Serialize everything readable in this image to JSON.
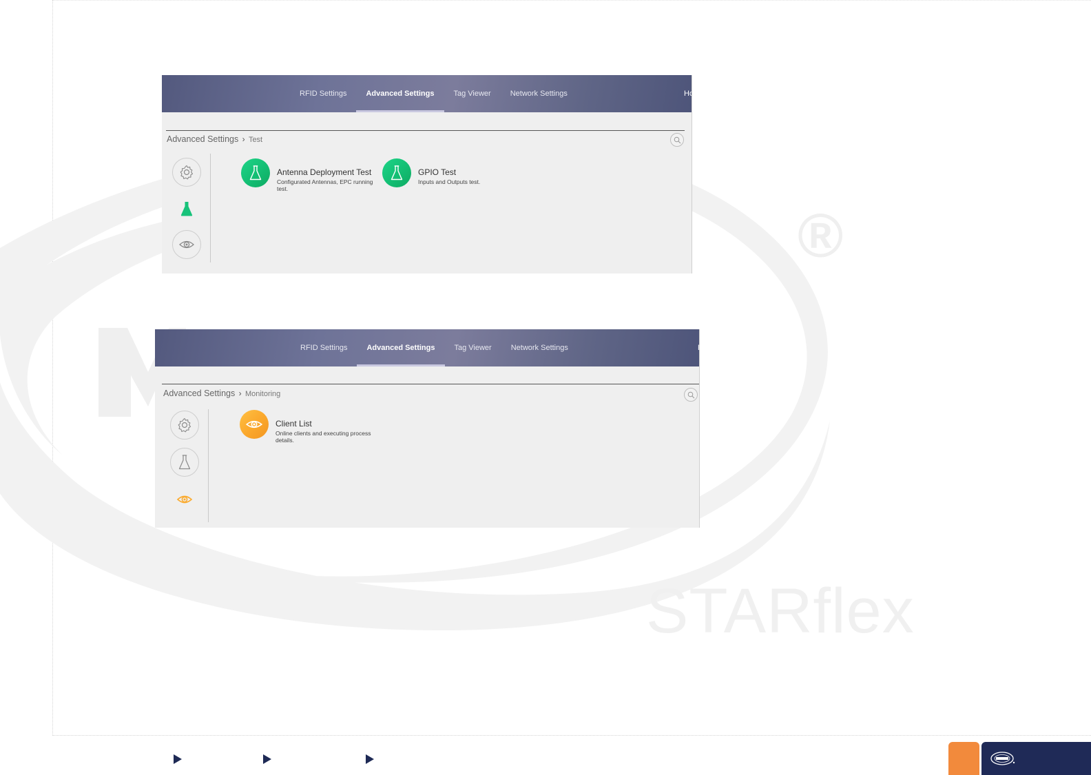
{
  "panels": {
    "test": {
      "nav": {
        "tabs": [
          "RFID Settings",
          "Advanced Settings",
          "Tag Viewer",
          "Network Settings"
        ],
        "active": "Advanced Settings",
        "right_label": "Ho"
      },
      "breadcrumb": {
        "root": "Advanced Settings",
        "separator": "›",
        "current": "Test"
      },
      "sidebar": [
        {
          "icon": "gear-icon",
          "active": false
        },
        {
          "icon": "flask-icon",
          "active": true
        },
        {
          "icon": "eye-icon",
          "active": false
        }
      ],
      "tiles": [
        {
          "icon": "flask-icon",
          "color": "#17c27a",
          "title": "Antenna Deployment Test",
          "desc_line1": "Configurated Antennas, EPC running",
          "desc_line2": "test."
        },
        {
          "icon": "flask-icon",
          "color": "#17c27a",
          "title": "GPIO Test",
          "desc_line1": "Inputs and Outputs test.",
          "desc_line2": ""
        }
      ]
    },
    "monitoring": {
      "nav": {
        "tabs": [
          "RFID Settings",
          "Advanced Settings",
          "Tag Viewer",
          "Network Settings"
        ],
        "active": "Advanced Settings",
        "right_label": "F"
      },
      "breadcrumb": {
        "root": "Advanced Settings",
        "separator": "›",
        "current": "Monitoring"
      },
      "sidebar": [
        {
          "icon": "gear-icon",
          "active": false
        },
        {
          "icon": "flask-icon",
          "active": false
        },
        {
          "icon": "eye-icon",
          "active": true
        }
      ],
      "tiles": [
        {
          "icon": "eye-icon",
          "color": "#fbab2f",
          "title": "Client List",
          "desc_line1": "Online clients and executing process",
          "desc_line2": "details."
        }
      ]
    }
  },
  "watermark": {
    "text": "STARflex",
    "mark": "®"
  },
  "footer": {
    "arrow_count": 3,
    "logo": "mojix-logo"
  },
  "colors": {
    "nav_bg": "#5f6586",
    "test_accent": "#17c27a",
    "monitor_accent": "#fbab2f",
    "footer_navy": "#1f2a57",
    "footer_orange": "#f28a3c"
  }
}
